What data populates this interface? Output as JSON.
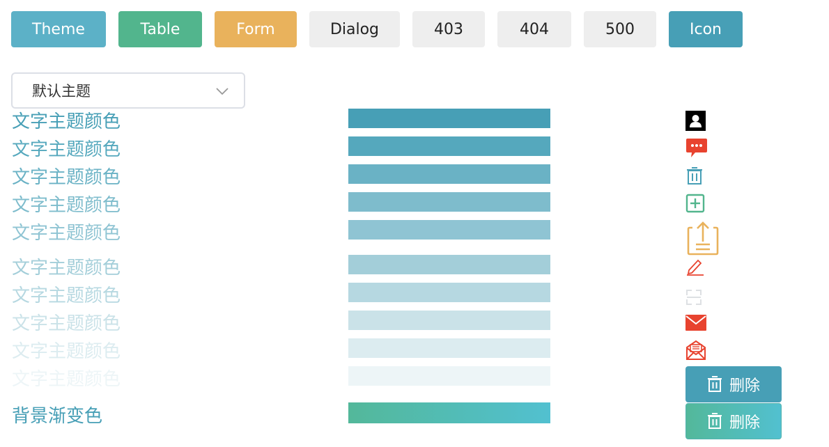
{
  "toolbar": {
    "buttons": [
      {
        "label": "Theme"
      },
      {
        "label": "Table"
      },
      {
        "label": "Form"
      },
      {
        "label": "Dialog"
      },
      {
        "label": "403"
      },
      {
        "label": "404"
      },
      {
        "label": "500"
      },
      {
        "label": "Icon"
      }
    ]
  },
  "theme_select": {
    "value": "默认主题"
  },
  "text_samples": [
    "文字主题颜色",
    "文字主题颜色",
    "文字主题颜色",
    "文字主题颜色",
    "文字主题颜色",
    "文字主题颜色",
    "文字主题颜色",
    "文字主题颜色",
    "文字主题颜色",
    "文字主题颜色"
  ],
  "gradient_label": "背景渐变色",
  "colors": {
    "primary": "#479fb6",
    "success": "#52b58d",
    "warning": "#e9b25c",
    "danger": "#e8432f",
    "neutral_bg": "#eeeeee",
    "shades": [
      "#479fb6",
      "#55a8bd",
      "#6ab2c5",
      "#7ebccc",
      "#8fc4d3",
      "#a3ced9",
      "#b6d8e1",
      "#cae2e8",
      "#dcecf0",
      "#edf5f7"
    ],
    "gradient": [
      "#53b89a",
      "#52c0d0"
    ]
  },
  "icons": [
    "user-icon",
    "chat-icon",
    "trash-icon",
    "plus-square-icon",
    "upload-clipboard-icon",
    "edit-pencil-icon",
    "scan-icon",
    "mail-icon",
    "mail-open-icon"
  ],
  "delete_buttons": [
    {
      "label": "删除"
    },
    {
      "label": "删除"
    }
  ]
}
